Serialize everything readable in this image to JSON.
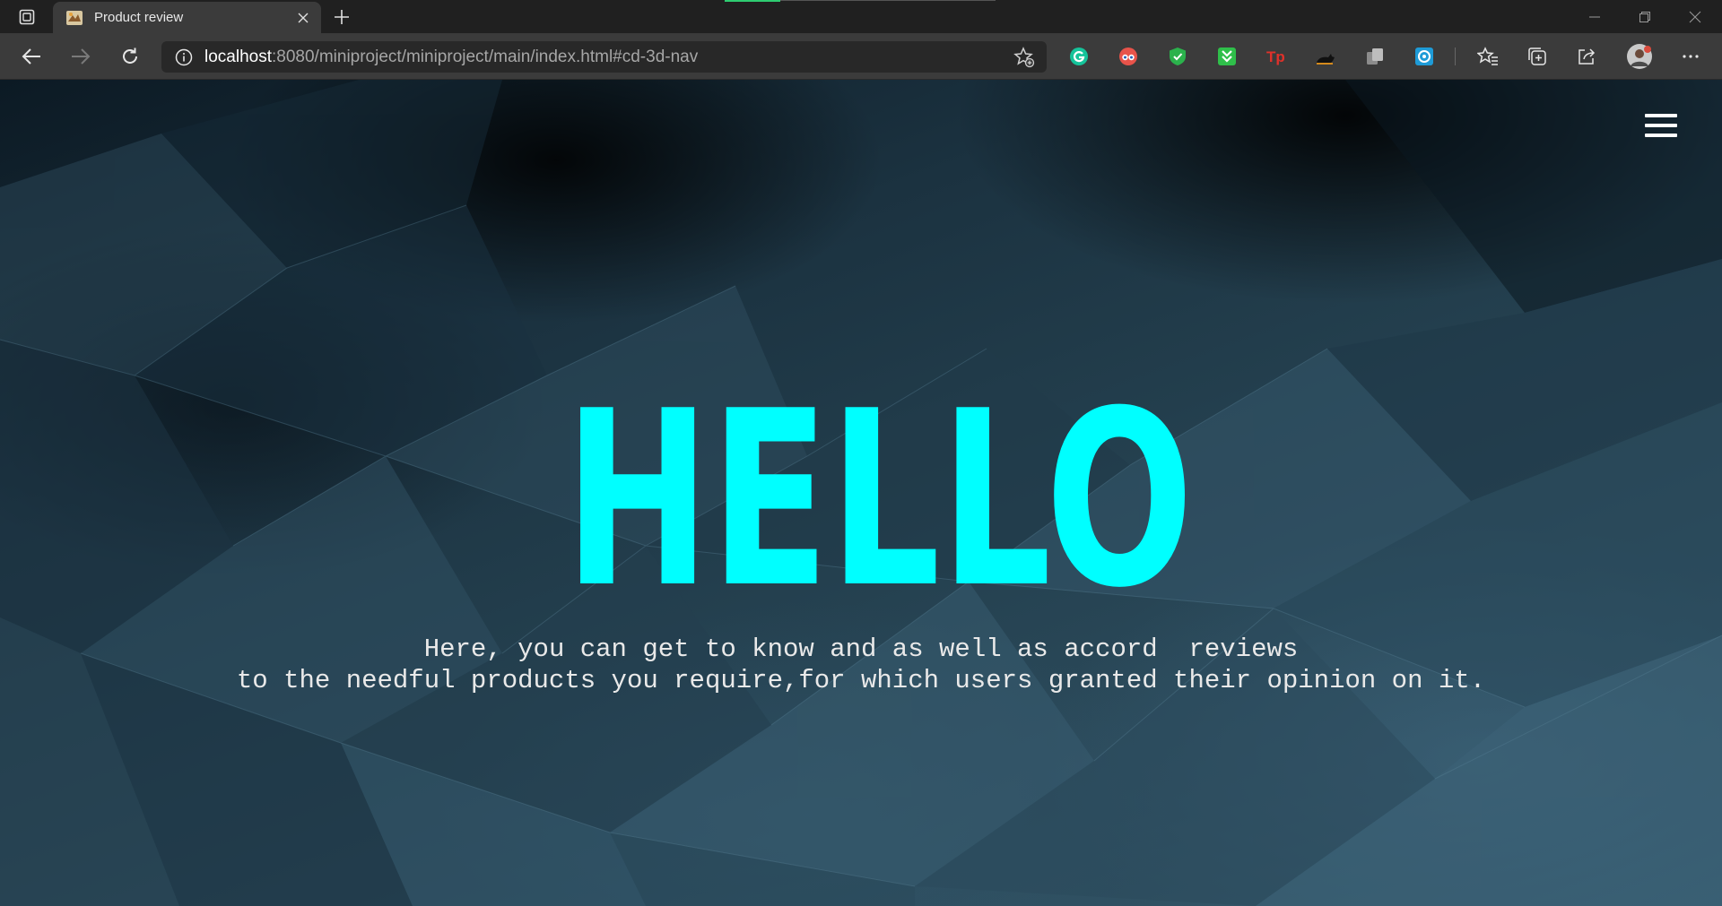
{
  "browser": {
    "tab": {
      "title": "Product review",
      "favicon": "product-review-favicon"
    },
    "address": {
      "host": "localhost",
      "rest": ":8080/miniproject/miniproject/main/index.html#cd-3d-nav"
    },
    "extensions": [
      "grammarly-icon",
      "eyes-extension-icon",
      "shield-extension-icon",
      "download-extension-icon",
      "tp-extension-icon",
      "cat-extension-icon",
      "copy-extension-icon",
      "circle-extension-icon"
    ]
  },
  "page": {
    "menu": "hamburger-menu-icon",
    "heading": "HELLO",
    "tagline": "Here, you can get to know and as well as accord  reviews\nto the needful products you require,for which users granted their opinion on it.",
    "colors": {
      "heading": "#00ffff",
      "text": "#e9e9e9",
      "background": "#1e3846"
    }
  }
}
